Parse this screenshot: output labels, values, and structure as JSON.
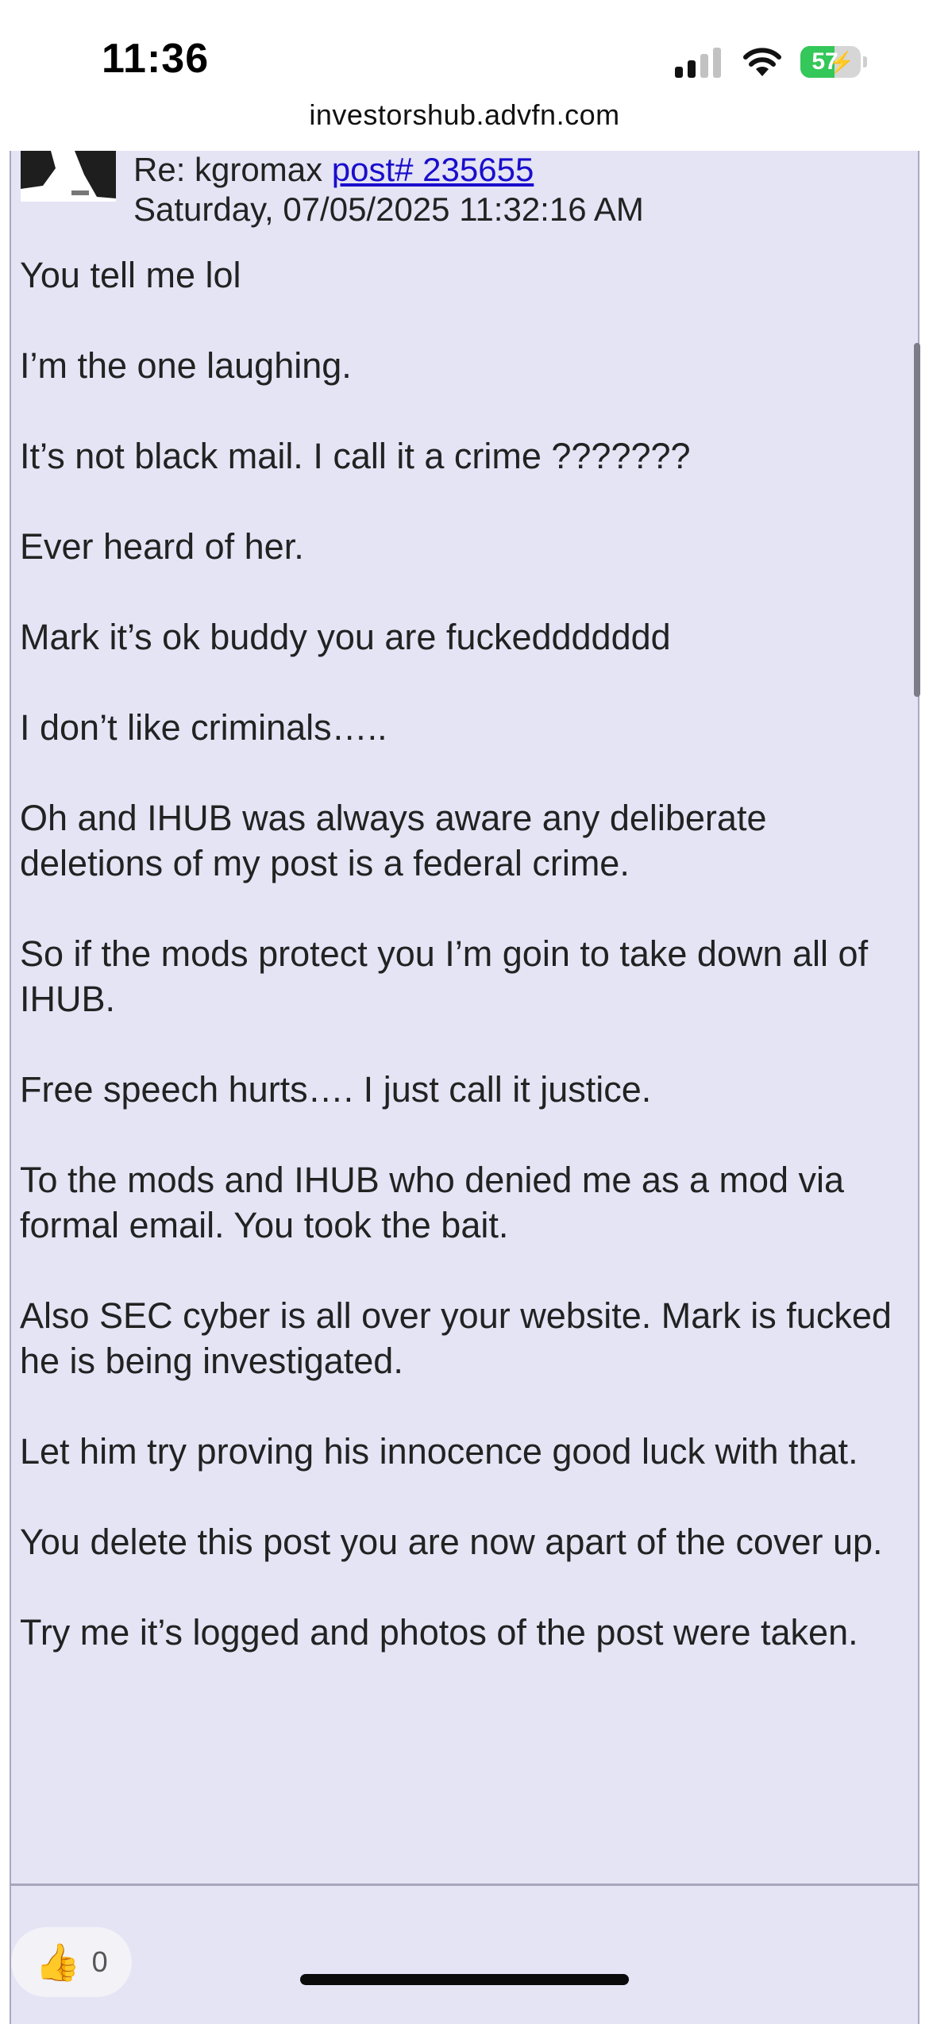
{
  "status_bar": {
    "time": "11:36",
    "battery_percent": "57",
    "battery_level": 0.57,
    "charging": true,
    "signal_bars": 2,
    "icons": [
      "signal-icon",
      "wifi-icon",
      "battery-icon"
    ]
  },
  "browser": {
    "url": "investorshub.advfn.com"
  },
  "post": {
    "reply_prefix": "Re: kgromax ",
    "reply_link": "post# 235655",
    "date": "Saturday, 07/05/2025 11:32:16 AM",
    "paragraphs": [
      "You tell me lol",
      "I’m the one laughing.",
      "It’s not black mail. I call it a crime ???????",
      "Ever heard of her.",
      "Mark it’s ok buddy you are fuckeddddddd",
      "I don’t like criminals…..",
      "Oh and IHUB was always aware any deliberate deletions of my post is a federal crime.",
      "So if the mods protect you I’m goin to take down all of IHUB.",
      "Free speech hurts…. I just call it justice.",
      "To the mods and IHUB who denied me as a mod via formal email. You took the bait.",
      "Also SEC cyber is all over your website. Mark is fucked he is being investigated.",
      "Let him try proving his innocence good luck with that.",
      "You delete this post you are now apart of the cover up.",
      "Try me it’s logged and photos of the post were taken."
    ]
  },
  "reactions": {
    "like_icon": "thumbs-up-icon",
    "like_count": "0"
  },
  "colors": {
    "post_background": "#e4e4f5",
    "link": "#1a0dcc",
    "battery_green": "#34c759"
  }
}
